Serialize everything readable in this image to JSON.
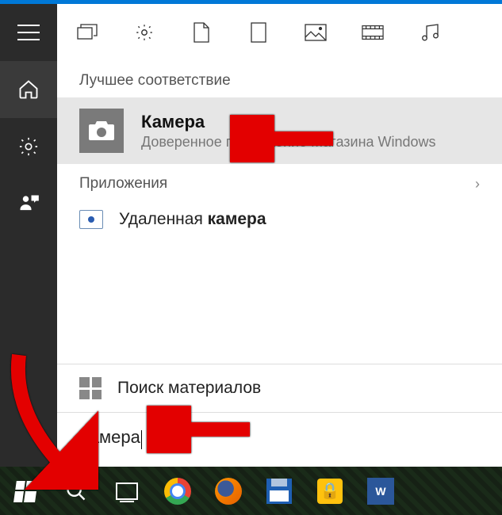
{
  "topbar_filters": [
    "apps",
    "settings",
    "documents",
    "folders",
    "photos",
    "videos",
    "music"
  ],
  "sections": {
    "best_match_header": "Лучшее соответствие",
    "apps_header": "Приложения"
  },
  "best_match": {
    "title": "Камера",
    "subtitle": "Доверенное приложение Магазина Windows"
  },
  "apps": {
    "removed_camera_pre": "Удаленная ",
    "removed_camera_bold": "камера"
  },
  "search_materials_label": "Поиск материалов",
  "search_input_value": "Камера",
  "taskbar": {
    "word_label": "W"
  }
}
